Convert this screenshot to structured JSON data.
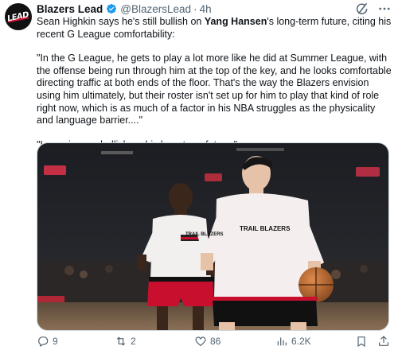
{
  "tweet": {
    "author_name": "Blazers Lead",
    "handle": "@BlazersLead",
    "separator": "·",
    "time": "4h",
    "avatar_text": "LEAD",
    "text": {
      "intro_before": "Sean Highkin says he's still bullish on ",
      "mention": "Yang Hansen",
      "intro_after": "'s long-term future, citing his recent G League comfortability:",
      "quote": "\"In the G League, he gets to play a lot more like he did at Summer League, with the offense being run through him at the top of the key, and he looks comfortable directing traffic at both ends of the floor. That's the way the Blazers envision using him ultimately, but their roster isn't set up for him to play that kind of role right now, which is as much of a factor in his NBA struggles as the physicality and language barrier....\"",
      "closing": "\"I remain very bullish on his long-term future.\""
    },
    "media": {
      "shirt_text_left": "TRAIL BLAZERS",
      "shirt_text_right": "TRAIL BLAZERS"
    },
    "actions": {
      "replies": "9",
      "reposts": "2",
      "likes": "86",
      "views": "6.2K"
    },
    "colors": {
      "verified": "#1d9bf0",
      "text": "#0f1419",
      "muted": "#536471",
      "brand_red": "#c8102e"
    },
    "icons": {
      "verified": "verified-badge-icon",
      "grok": "grok-icon",
      "more": "more-icon",
      "reply": "reply-icon",
      "repost": "repost-icon",
      "like": "heart-icon",
      "views": "views-chart-icon",
      "bookmark": "bookmark-icon",
      "share": "share-icon"
    }
  }
}
